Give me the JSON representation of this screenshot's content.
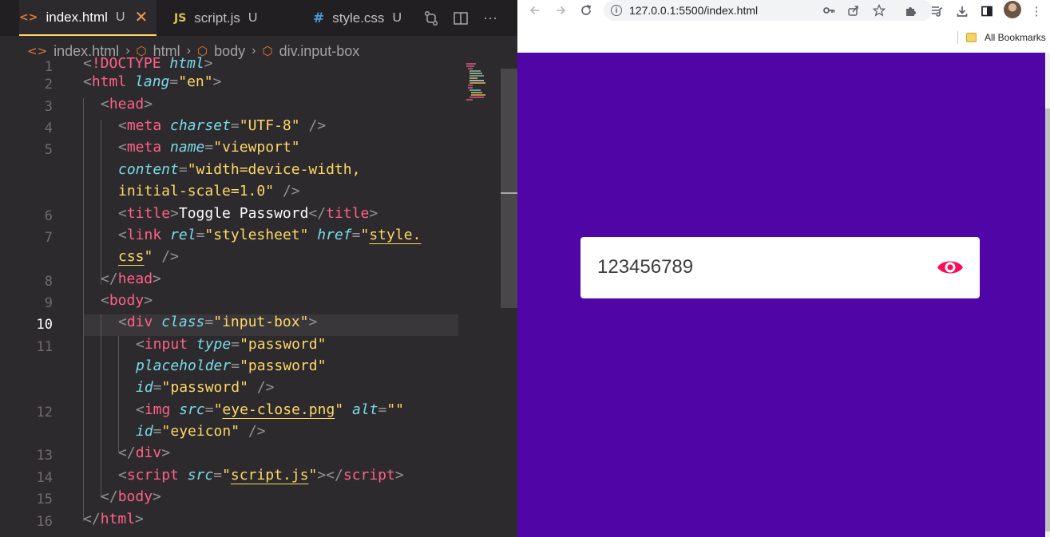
{
  "editor": {
    "tabs": [
      {
        "icon": "<>",
        "label": "index.html",
        "status": "U",
        "active": true
      },
      {
        "icon": "JS",
        "label": "script.js",
        "status": "U",
        "active": false
      },
      {
        "icon": "#",
        "label": "style.css",
        "status": "U",
        "active": false
      }
    ],
    "breadcrumb": [
      "index.html",
      "html",
      "body",
      "div.input-box"
    ],
    "line_numbers": [
      "1",
      "2",
      "3",
      "4",
      "5",
      "6",
      "7",
      "8",
      "9",
      "10",
      "11",
      "12",
      "13",
      "14",
      "15",
      "16"
    ],
    "active_line": "10"
  },
  "browser": {
    "url": "127.0.0.1:5500/index.html",
    "bookmarks_label": "All Bookmarks",
    "page": {
      "background": "#5005a7",
      "password_value": "123456789",
      "password_placeholder": "password",
      "eye_icon_color": "#ff0a54"
    }
  }
}
